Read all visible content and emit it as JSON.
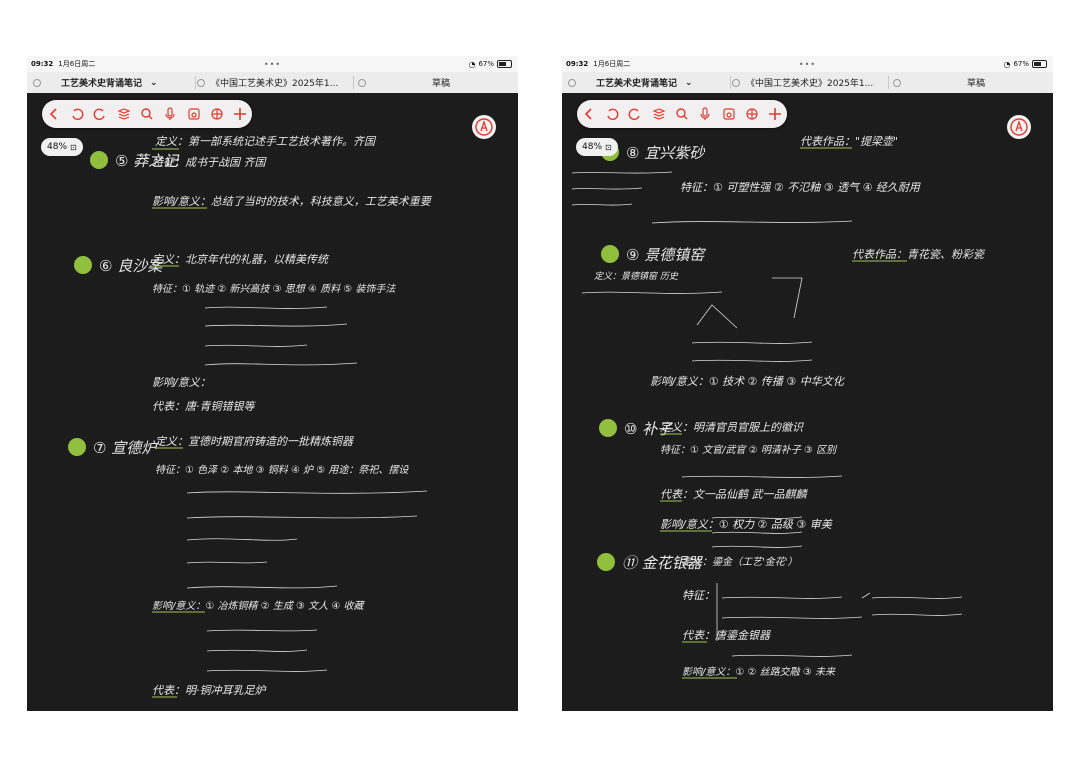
{
  "colors": {
    "ink": "#e6e6e6",
    "green": "#9fc34f",
    "purple": "#a98ce0",
    "accent": "#e23a2e"
  },
  "screens": [
    {
      "status": {
        "time": "09:32",
        "date": "1月6日周二",
        "battery": "67%"
      },
      "tabs": [
        {
          "label": "工艺美术史背诵笔记"
        },
        {
          "label": "《中国工艺美术史》2025年1..."
        },
        {
          "label": "草稿"
        }
      ],
      "zoom": "48%",
      "notes": [
        {
          "text": "⑤ 莽之记",
          "color": "ink"
        },
        {
          "text": "定义：第一部系统记述手工艺技术著作。齐国",
          "color": "ink"
        },
        {
          "text": "特征：成书于战国 齐国",
          "color": "ink"
        },
        {
          "text": "影响/意义：总结了当时的技术，科技意义，工艺美术重要",
          "color": "ink"
        },
        {
          "text": "⑥ 良沙案",
          "color": "ink"
        },
        {
          "text": "定义：北京年代的礼器，以精美传统",
          "color": "ink"
        },
        {
          "text": "特征：① 轨迹 ② 新兴高技 ③ 思想 ④ 质料 ⑤ 装饰手法",
          "color": "ink"
        },
        {
          "text": "影响/意义：",
          "color": "ink"
        },
        {
          "text": "代表：唐·青铜错银等",
          "color": "ink"
        },
        {
          "text": "⑦ 宣德炉",
          "color": "ink"
        },
        {
          "text": "定义：宣德时期官府铸造的一批精炼铜器",
          "color": "ink"
        },
        {
          "text": "特征：① 色泽 ② 本地 ③ 铜料 ④ 炉 ⑤ 用途：祭祀、摆设",
          "color": "ink"
        },
        {
          "text": "影响/意义：① 冶炼铜精 ② 生成 ③ 文人 ④ 收藏",
          "color": "ink"
        },
        {
          "text": "代表：明·铜冲耳乳足炉",
          "color": "ink"
        }
      ]
    },
    {
      "status": {
        "time": "09:32",
        "date": "1月6日周二",
        "battery": "67%"
      },
      "tabs": [
        {
          "label": "工艺美术史背诵笔记"
        },
        {
          "label": "《中国工艺美术史》2025年1..."
        },
        {
          "label": "草稿"
        }
      ],
      "zoom": "48%",
      "notes": [
        {
          "text": "⑧ 宜兴紫砂",
          "color": "ink"
        },
        {
          "text": "代表作品：\"提梁壶\"",
          "color": "ink"
        },
        {
          "text": "特征：① 可塑性强 ② 不氾釉 ③ 透气 ④ 经久耐用",
          "color": "ink"
        },
        {
          "text": "⑨ 景德镇窑",
          "color": "ink"
        },
        {
          "text": "代表作品：青花瓷、粉彩瓷",
          "color": "ink"
        },
        {
          "text": "定义：景德镇窑 历史",
          "color": "ink"
        },
        {
          "text": "影响/意义：① 技术 ② 传播 ③ 中华文化",
          "color": "ink"
        },
        {
          "text": "⑩ 补子",
          "color": "ink"
        },
        {
          "text": "定义：明清官员官服上的徽识",
          "color": "ink"
        },
        {
          "text": "特征：① 文官/武官 ② 明清补子 ③ 区别",
          "color": "ink"
        },
        {
          "text": "代表：文一品仙鹤 武一品麒麟",
          "color": "ink"
        },
        {
          "text": "影响/意义：① 权力 ② 品级 ③ 审美",
          "color": "ink"
        },
        {
          "text": "⑪ 金花银器",
          "color": "ink"
        },
        {
          "text": "定义：鎏金（工艺'金花'）",
          "color": "ink"
        },
        {
          "text": "特征：",
          "color": "ink"
        },
        {
          "text": "代表：唐鎏金银器",
          "color": "ink"
        },
        {
          "text": "影响/意义：① ② 丝路交融 ③ 未来",
          "color": "ink"
        }
      ]
    }
  ]
}
